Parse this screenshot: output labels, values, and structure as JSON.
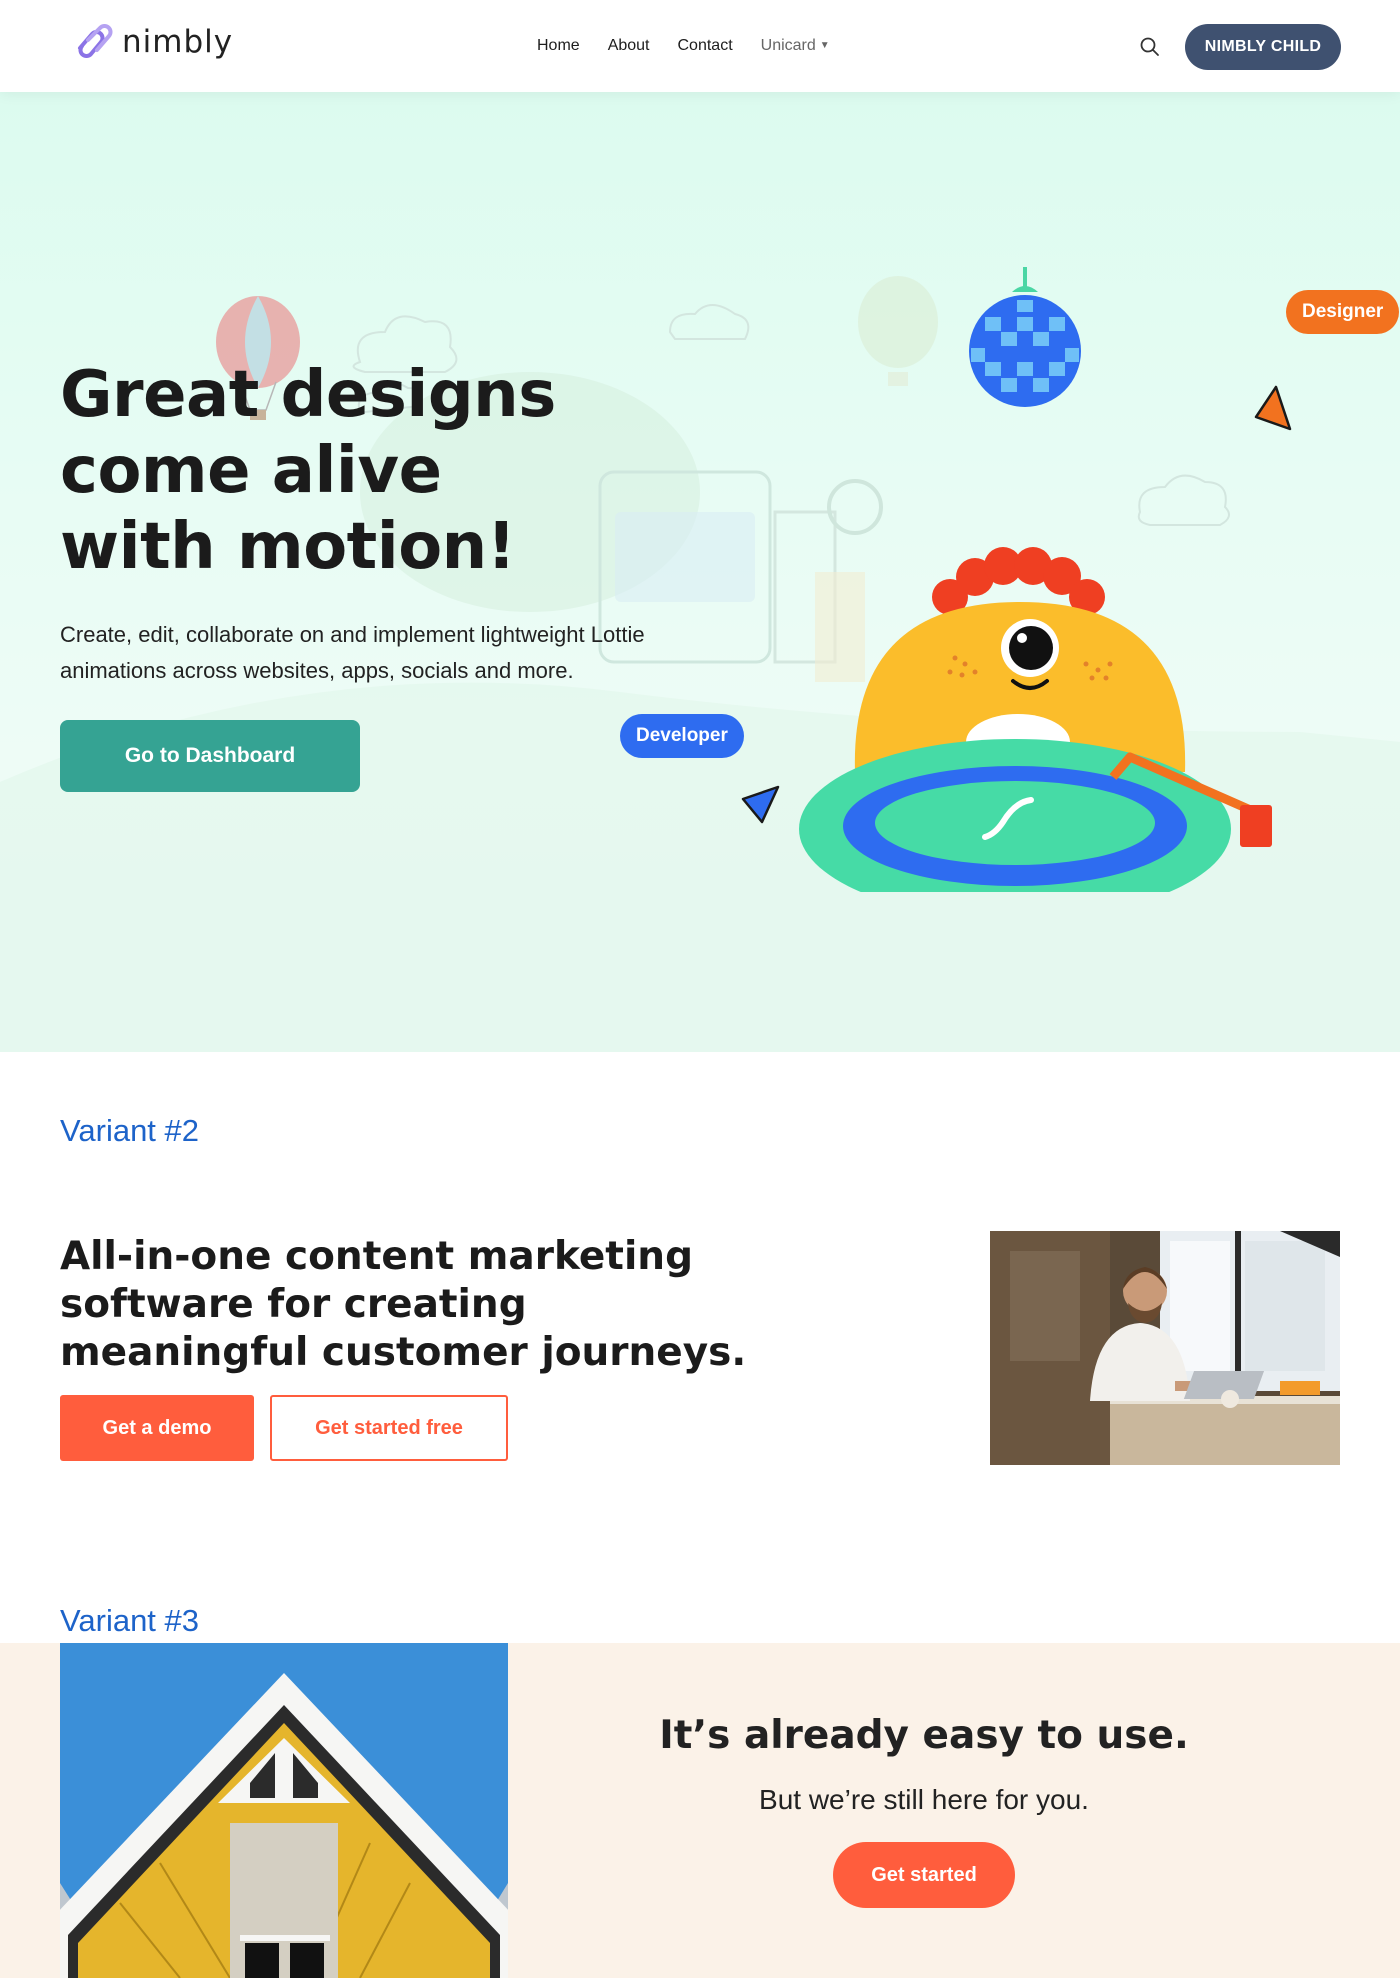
{
  "header": {
    "logo_text": "nimbly",
    "nav": [
      {
        "label": "Home"
      },
      {
        "label": "About"
      },
      {
        "label": "Contact"
      },
      {
        "label": "Unicard"
      }
    ],
    "cta_label": "NIMBLY CHILD"
  },
  "hero": {
    "title_line1": "Great designs",
    "title_line2": "come alive",
    "title_line3": "with motion!",
    "subtitle": "Create, edit, collaborate on and implement lightweight Lottie animations across websites, apps, socials and more.",
    "button_label": "Go to Dashboard",
    "tag_designer": "Designer",
    "tag_developer": "Developer"
  },
  "variant2": {
    "label": "Variant #2",
    "title": "All-in-one content marketing software for creating meaningful customer journeys.",
    "primary_button": "Get a demo",
    "secondary_button": "Get started free"
  },
  "variant3": {
    "label": "Variant #3",
    "title": "It’s already easy to use.",
    "subtitle": "But we’re still here for you.",
    "button_label": "Get started"
  },
  "colors": {
    "accent_orange": "#ff5d3d",
    "teal_button": "#35a393",
    "navy_pill": "#3f5170",
    "variant_label": "#1d63c9",
    "hero_bg": "#dcfbef",
    "band_bg": "#fbf2e8"
  }
}
